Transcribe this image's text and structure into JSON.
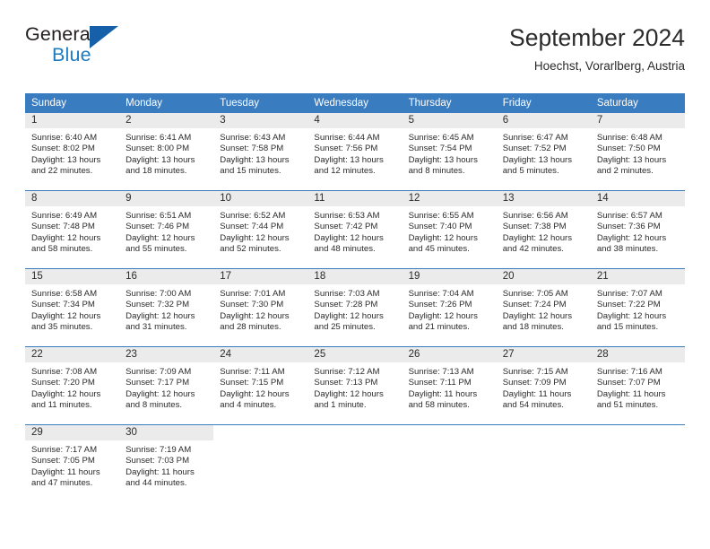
{
  "brand": {
    "name_part1": "General",
    "name_part2": "Blue",
    "triangle_color": "#1560a8",
    "blue_text_color": "#1c7bc1"
  },
  "header": {
    "title": "September 2024",
    "location": "Hoechst, Vorarlberg, Austria"
  },
  "theme": {
    "header_blue": "#3a7cc0",
    "daynum_band": "#ebebeb",
    "text": "#2b2b2b"
  },
  "weekday_headers": [
    "Sunday",
    "Monday",
    "Tuesday",
    "Wednesday",
    "Thursday",
    "Friday",
    "Saturday"
  ],
  "weeks": [
    [
      {
        "day": "1",
        "sunrise": "Sunrise: 6:40 AM",
        "sunset": "Sunset: 8:02 PM",
        "daylight1": "Daylight: 13 hours",
        "daylight2": "and 22 minutes."
      },
      {
        "day": "2",
        "sunrise": "Sunrise: 6:41 AM",
        "sunset": "Sunset: 8:00 PM",
        "daylight1": "Daylight: 13 hours",
        "daylight2": "and 18 minutes."
      },
      {
        "day": "3",
        "sunrise": "Sunrise: 6:43 AM",
        "sunset": "Sunset: 7:58 PM",
        "daylight1": "Daylight: 13 hours",
        "daylight2": "and 15 minutes."
      },
      {
        "day": "4",
        "sunrise": "Sunrise: 6:44 AM",
        "sunset": "Sunset: 7:56 PM",
        "daylight1": "Daylight: 13 hours",
        "daylight2": "and 12 minutes."
      },
      {
        "day": "5",
        "sunrise": "Sunrise: 6:45 AM",
        "sunset": "Sunset: 7:54 PM",
        "daylight1": "Daylight: 13 hours",
        "daylight2": "and 8 minutes."
      },
      {
        "day": "6",
        "sunrise": "Sunrise: 6:47 AM",
        "sunset": "Sunset: 7:52 PM",
        "daylight1": "Daylight: 13 hours",
        "daylight2": "and 5 minutes."
      },
      {
        "day": "7",
        "sunrise": "Sunrise: 6:48 AM",
        "sunset": "Sunset: 7:50 PM",
        "daylight1": "Daylight: 13 hours",
        "daylight2": "and 2 minutes."
      }
    ],
    [
      {
        "day": "8",
        "sunrise": "Sunrise: 6:49 AM",
        "sunset": "Sunset: 7:48 PM",
        "daylight1": "Daylight: 12 hours",
        "daylight2": "and 58 minutes."
      },
      {
        "day": "9",
        "sunrise": "Sunrise: 6:51 AM",
        "sunset": "Sunset: 7:46 PM",
        "daylight1": "Daylight: 12 hours",
        "daylight2": "and 55 minutes."
      },
      {
        "day": "10",
        "sunrise": "Sunrise: 6:52 AM",
        "sunset": "Sunset: 7:44 PM",
        "daylight1": "Daylight: 12 hours",
        "daylight2": "and 52 minutes."
      },
      {
        "day": "11",
        "sunrise": "Sunrise: 6:53 AM",
        "sunset": "Sunset: 7:42 PM",
        "daylight1": "Daylight: 12 hours",
        "daylight2": "and 48 minutes."
      },
      {
        "day": "12",
        "sunrise": "Sunrise: 6:55 AM",
        "sunset": "Sunset: 7:40 PM",
        "daylight1": "Daylight: 12 hours",
        "daylight2": "and 45 minutes."
      },
      {
        "day": "13",
        "sunrise": "Sunrise: 6:56 AM",
        "sunset": "Sunset: 7:38 PM",
        "daylight1": "Daylight: 12 hours",
        "daylight2": "and 42 minutes."
      },
      {
        "day": "14",
        "sunrise": "Sunrise: 6:57 AM",
        "sunset": "Sunset: 7:36 PM",
        "daylight1": "Daylight: 12 hours",
        "daylight2": "and 38 minutes."
      }
    ],
    [
      {
        "day": "15",
        "sunrise": "Sunrise: 6:58 AM",
        "sunset": "Sunset: 7:34 PM",
        "daylight1": "Daylight: 12 hours",
        "daylight2": "and 35 minutes."
      },
      {
        "day": "16",
        "sunrise": "Sunrise: 7:00 AM",
        "sunset": "Sunset: 7:32 PM",
        "daylight1": "Daylight: 12 hours",
        "daylight2": "and 31 minutes."
      },
      {
        "day": "17",
        "sunrise": "Sunrise: 7:01 AM",
        "sunset": "Sunset: 7:30 PM",
        "daylight1": "Daylight: 12 hours",
        "daylight2": "and 28 minutes."
      },
      {
        "day": "18",
        "sunrise": "Sunrise: 7:03 AM",
        "sunset": "Sunset: 7:28 PM",
        "daylight1": "Daylight: 12 hours",
        "daylight2": "and 25 minutes."
      },
      {
        "day": "19",
        "sunrise": "Sunrise: 7:04 AM",
        "sunset": "Sunset: 7:26 PM",
        "daylight1": "Daylight: 12 hours",
        "daylight2": "and 21 minutes."
      },
      {
        "day": "20",
        "sunrise": "Sunrise: 7:05 AM",
        "sunset": "Sunset: 7:24 PM",
        "daylight1": "Daylight: 12 hours",
        "daylight2": "and 18 minutes."
      },
      {
        "day": "21",
        "sunrise": "Sunrise: 7:07 AM",
        "sunset": "Sunset: 7:22 PM",
        "daylight1": "Daylight: 12 hours",
        "daylight2": "and 15 minutes."
      }
    ],
    [
      {
        "day": "22",
        "sunrise": "Sunrise: 7:08 AM",
        "sunset": "Sunset: 7:20 PM",
        "daylight1": "Daylight: 12 hours",
        "daylight2": "and 11 minutes."
      },
      {
        "day": "23",
        "sunrise": "Sunrise: 7:09 AM",
        "sunset": "Sunset: 7:17 PM",
        "daylight1": "Daylight: 12 hours",
        "daylight2": "and 8 minutes."
      },
      {
        "day": "24",
        "sunrise": "Sunrise: 7:11 AM",
        "sunset": "Sunset: 7:15 PM",
        "daylight1": "Daylight: 12 hours",
        "daylight2": "and 4 minutes."
      },
      {
        "day": "25",
        "sunrise": "Sunrise: 7:12 AM",
        "sunset": "Sunset: 7:13 PM",
        "daylight1": "Daylight: 12 hours",
        "daylight2": "and 1 minute."
      },
      {
        "day": "26",
        "sunrise": "Sunrise: 7:13 AM",
        "sunset": "Sunset: 7:11 PM",
        "daylight1": "Daylight: 11 hours",
        "daylight2": "and 58 minutes."
      },
      {
        "day": "27",
        "sunrise": "Sunrise: 7:15 AM",
        "sunset": "Sunset: 7:09 PM",
        "daylight1": "Daylight: 11 hours",
        "daylight2": "and 54 minutes."
      },
      {
        "day": "28",
        "sunrise": "Sunrise: 7:16 AM",
        "sunset": "Sunset: 7:07 PM",
        "daylight1": "Daylight: 11 hours",
        "daylight2": "and 51 minutes."
      }
    ],
    [
      {
        "day": "29",
        "sunrise": "Sunrise: 7:17 AM",
        "sunset": "Sunset: 7:05 PM",
        "daylight1": "Daylight: 11 hours",
        "daylight2": "and 47 minutes."
      },
      {
        "day": "30",
        "sunrise": "Sunrise: 7:19 AM",
        "sunset": "Sunset: 7:03 PM",
        "daylight1": "Daylight: 11 hours",
        "daylight2": "and 44 minutes."
      },
      {
        "day": "",
        "sunrise": "",
        "sunset": "",
        "daylight1": "",
        "daylight2": ""
      },
      {
        "day": "",
        "sunrise": "",
        "sunset": "",
        "daylight1": "",
        "daylight2": ""
      },
      {
        "day": "",
        "sunrise": "",
        "sunset": "",
        "daylight1": "",
        "daylight2": ""
      },
      {
        "day": "",
        "sunrise": "",
        "sunset": "",
        "daylight1": "",
        "daylight2": ""
      },
      {
        "day": "",
        "sunrise": "",
        "sunset": "",
        "daylight1": "",
        "daylight2": ""
      }
    ]
  ]
}
